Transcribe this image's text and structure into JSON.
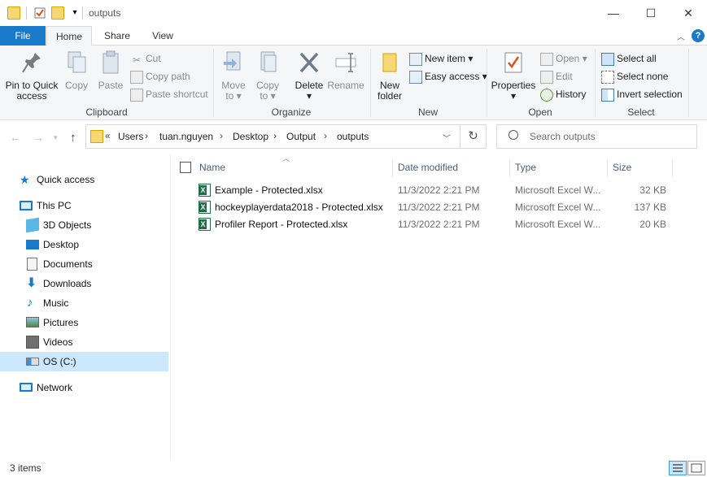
{
  "window": {
    "title": "outputs",
    "controls": {
      "minimize": "—",
      "maximize": "☐",
      "close": "✕"
    }
  },
  "ribbon_tabs": [
    "File",
    "Home",
    "Share",
    "View"
  ],
  "ribbon": {
    "clipboard": {
      "label": "Clipboard",
      "pin": "Pin to Quick\naccess",
      "copy": "Copy",
      "paste": "Paste",
      "cut": "Cut",
      "copy_path": "Copy path",
      "paste_shortcut": "Paste shortcut"
    },
    "organize": {
      "label": "Organize",
      "move_to": "Move\nto ▾",
      "copy_to": "Copy\nto ▾",
      "delete": "Delete\n▾",
      "rename": "Rename"
    },
    "new": {
      "label": "New",
      "new_folder": "New\nfolder",
      "new_item": "New item ▾",
      "easy_access": "Easy access ▾"
    },
    "open": {
      "label": "Open",
      "properties": "Properties\n▾",
      "open": "Open ▾",
      "edit": "Edit",
      "history": "History"
    },
    "select": {
      "label": "Select",
      "select_all": "Select all",
      "select_none": "Select none",
      "invert": "Invert selection"
    }
  },
  "address": {
    "overflow": "«",
    "crumbs": [
      "Users",
      "tuan.nguyen",
      "Desktop",
      "Output",
      "outputs"
    ],
    "search_placeholder": "Search outputs"
  },
  "nav_pane": {
    "items": [
      {
        "label": "Quick access",
        "icon": "star-icon"
      },
      {
        "label": "This PC",
        "icon": "pc-icon"
      },
      {
        "label": "3D Objects",
        "icon": "cube-icon"
      },
      {
        "label": "Desktop",
        "icon": "desktop-icon"
      },
      {
        "label": "Documents",
        "icon": "document-icon"
      },
      {
        "label": "Downloads",
        "icon": "download-icon"
      },
      {
        "label": "Music",
        "icon": "music-icon"
      },
      {
        "label": "Pictures",
        "icon": "pictures-icon"
      },
      {
        "label": "Videos",
        "icon": "videos-icon"
      },
      {
        "label": "OS (C:)",
        "icon": "drive-icon"
      },
      {
        "label": "Network",
        "icon": "network-icon"
      }
    ]
  },
  "file_list": {
    "columns": [
      "Name",
      "Date modified",
      "Type",
      "Size"
    ],
    "rows": [
      {
        "name": "Example - Protected.xlsx",
        "date": "11/3/2022 2:21 PM",
        "type": "Microsoft Excel W...",
        "size": "32 KB"
      },
      {
        "name": "hockeyplayerdata2018 - Protected.xlsx",
        "date": "11/3/2022 2:21 PM",
        "type": "Microsoft Excel W...",
        "size": "137 KB"
      },
      {
        "name": "Profiler Report - Protected.xlsx",
        "date": "11/3/2022 2:21 PM",
        "type": "Microsoft Excel W...",
        "size": "20 KB"
      }
    ]
  },
  "status": {
    "count": "3 items"
  },
  "colors": {
    "accent": "#1979ca",
    "selection": "#cce8ff",
    "folder": "#f8d775",
    "excel": "#1d7044"
  }
}
